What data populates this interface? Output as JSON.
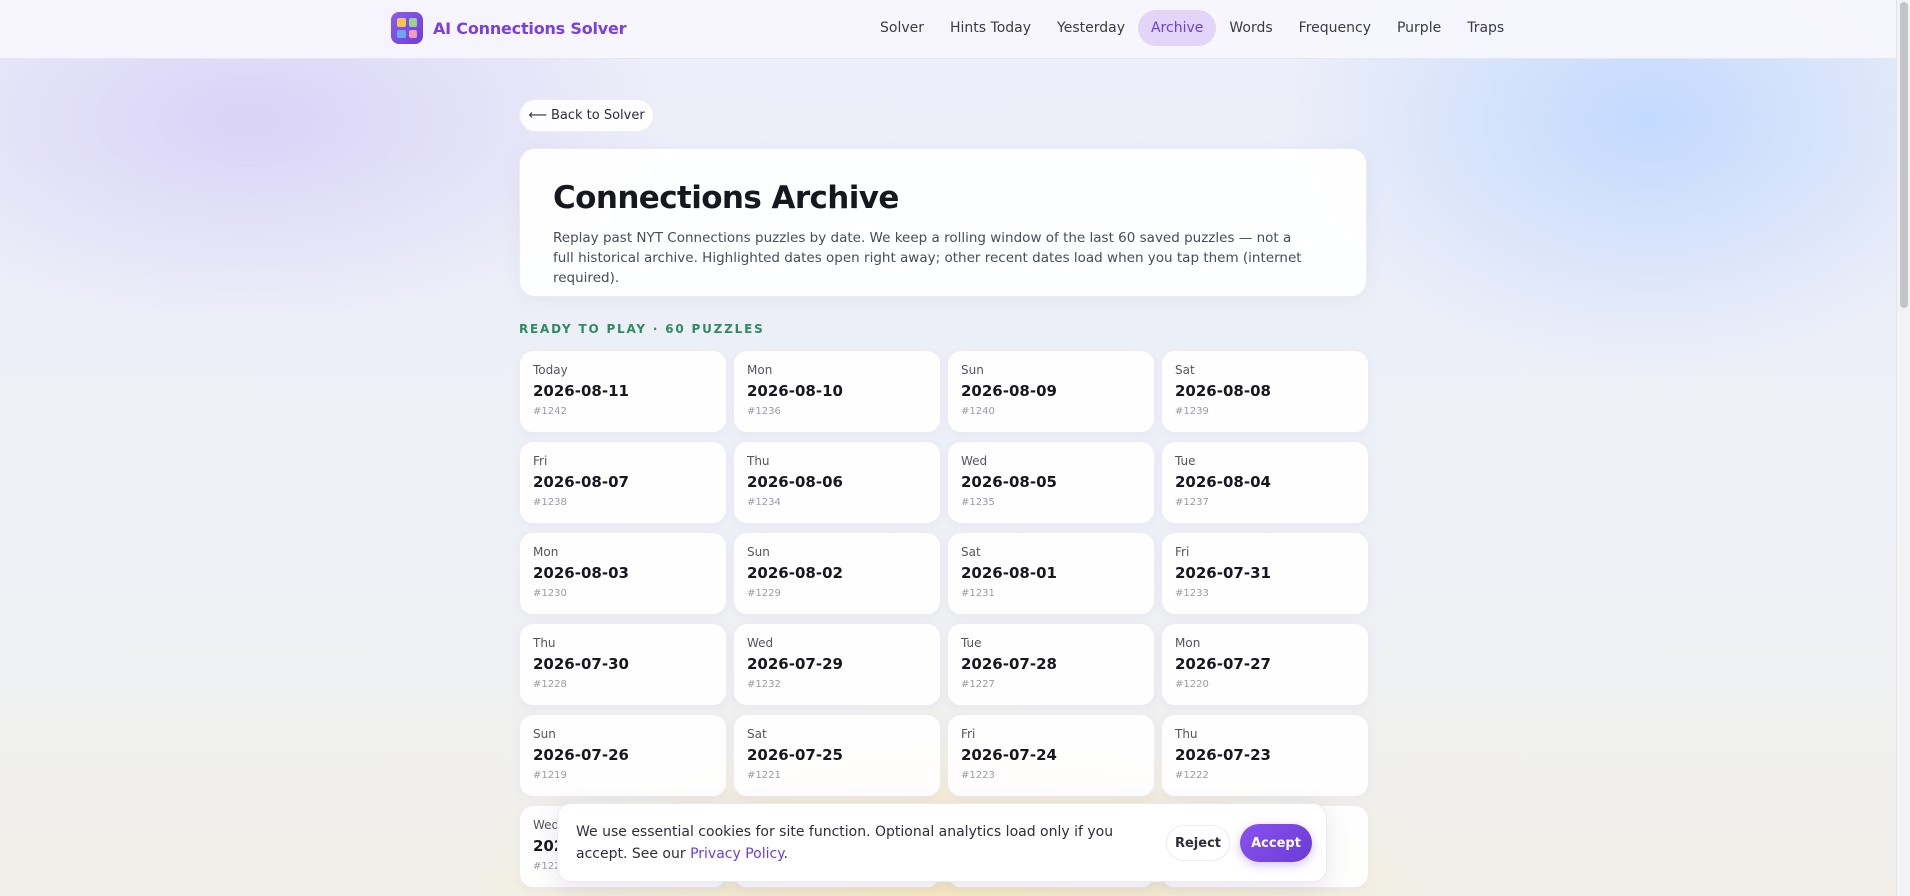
{
  "brand": {
    "name": "AI Connections Solver",
    "logo_colors": [
      "#f6c453",
      "#9ed38f",
      "#6aa8f0",
      "#f29bb8"
    ]
  },
  "nav": {
    "items": [
      {
        "label": "Solver",
        "active": false
      },
      {
        "label": "Hints Today",
        "active": false
      },
      {
        "label": "Yesterday",
        "active": false
      },
      {
        "label": "Archive",
        "active": true
      },
      {
        "label": "Words",
        "active": false
      },
      {
        "label": "Frequency",
        "active": false
      },
      {
        "label": "Purple",
        "active": false
      },
      {
        "label": "Traps",
        "active": false
      }
    ]
  },
  "back_button": {
    "arrow": "⟵",
    "label": "Back to Solver"
  },
  "hero": {
    "title": "Connections Archive",
    "description": "Replay past NYT Connections puzzles by date. We keep a rolling window of the last 60 saved puzzles — not a full historical archive. Highlighted dates open right away; other recent dates load when you tap them (internet required)."
  },
  "section": {
    "label": "READY TO PLAY · 60 PUZZLES"
  },
  "puzzles": [
    {
      "day": "Today",
      "date": "2026-08-11",
      "number": "#1242"
    },
    {
      "day": "Mon",
      "date": "2026-08-10",
      "number": "#1236"
    },
    {
      "day": "Sun",
      "date": "2026-08-09",
      "number": "#1240"
    },
    {
      "day": "Sat",
      "date": "2026-08-08",
      "number": "#1239"
    },
    {
      "day": "Fri",
      "date": "2026-08-07",
      "number": "#1238"
    },
    {
      "day": "Thu",
      "date": "2026-08-06",
      "number": "#1234"
    },
    {
      "day": "Wed",
      "date": "2026-08-05",
      "number": "#1235"
    },
    {
      "day": "Tue",
      "date": "2026-08-04",
      "number": "#1237"
    },
    {
      "day": "Mon",
      "date": "2026-08-03",
      "number": "#1230"
    },
    {
      "day": "Sun",
      "date": "2026-08-02",
      "number": "#1229"
    },
    {
      "day": "Sat",
      "date": "2026-08-01",
      "number": "#1231"
    },
    {
      "day": "Fri",
      "date": "2026-07-31",
      "number": "#1233"
    },
    {
      "day": "Thu",
      "date": "2026-07-30",
      "number": "#1228"
    },
    {
      "day": "Wed",
      "date": "2026-07-29",
      "number": "#1232"
    },
    {
      "day": "Tue",
      "date": "2026-07-28",
      "number": "#1227"
    },
    {
      "day": "Mon",
      "date": "2026-07-27",
      "number": "#1220"
    },
    {
      "day": "Sun",
      "date": "2026-07-26",
      "number": "#1219"
    },
    {
      "day": "Sat",
      "date": "2026-07-25",
      "number": "#1221"
    },
    {
      "day": "Fri",
      "date": "2026-07-24",
      "number": "#1223"
    },
    {
      "day": "Thu",
      "date": "2026-07-23",
      "number": "#1222"
    },
    {
      "day": "Wed",
      "date": "202",
      "number": "#1225"
    },
    {
      "day": "",
      "date": "",
      "number": ""
    },
    {
      "day": "",
      "date": "",
      "number": ""
    },
    {
      "day": "",
      "date": "",
      "number": ""
    }
  ],
  "cookie_banner": {
    "text": "We use essential cookies for site function. Optional analytics load only if you accept. See our ",
    "link": "Privacy Policy",
    "suffix": ".",
    "reject_label": "Reject",
    "accept_label": "Accept"
  }
}
